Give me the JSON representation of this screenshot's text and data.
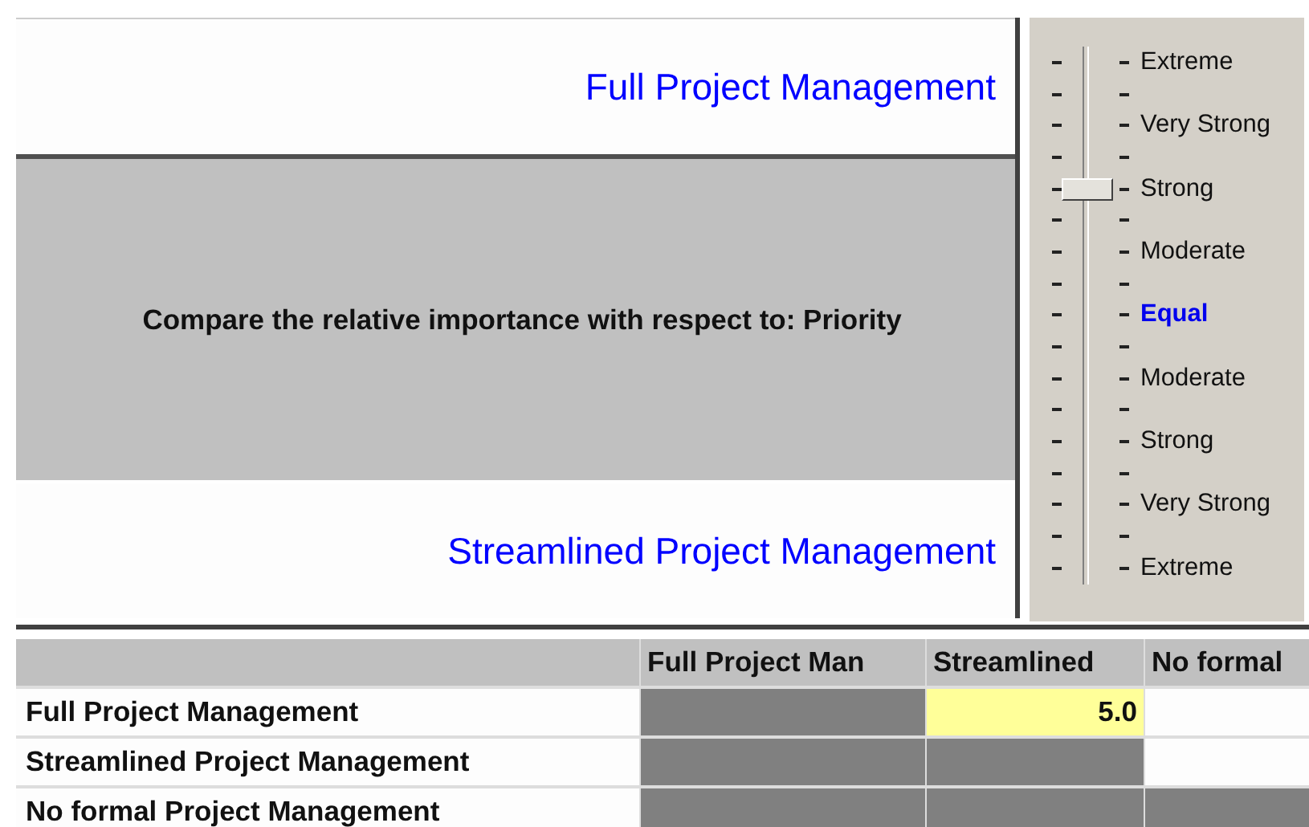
{
  "comparison": {
    "top_option": "Full Project Management",
    "prompt": "Compare the relative importance with respect to: Priority",
    "bottom_option": "Streamlined Project Management"
  },
  "scale": {
    "level": 0.75,
    "labels": [
      {
        "text": "Extreme",
        "highlighted": false
      },
      {
        "text": "Very Strong",
        "highlighted": false
      },
      {
        "text": "Strong",
        "highlighted": false
      },
      {
        "text": "Moderate",
        "highlighted": false
      },
      {
        "text": "Equal",
        "highlighted": true
      },
      {
        "text": "Moderate",
        "highlighted": false
      },
      {
        "text": "Strong",
        "highlighted": false
      },
      {
        "text": "Very Strong",
        "highlighted": false
      },
      {
        "text": "Extreme",
        "highlighted": false
      }
    ]
  },
  "table": {
    "columns": [
      "Full Project Man",
      "Streamlined",
      "No formal"
    ],
    "rows": [
      {
        "label": "Full Project Management",
        "cells": [
          {
            "kind": "blocked"
          },
          {
            "kind": "entry",
            "value": "5.0",
            "selected": true
          },
          {
            "kind": "entry",
            "selected": false
          }
        ]
      },
      {
        "label": "Streamlined Project Management",
        "cells": [
          {
            "kind": "blocked"
          },
          {
            "kind": "blocked"
          },
          {
            "kind": "entry",
            "selected": false
          }
        ]
      },
      {
        "label": "No formal Project Management",
        "cells": [
          {
            "kind": "blocked"
          },
          {
            "kind": "blocked"
          },
          {
            "kind": "blocked"
          }
        ]
      }
    ]
  }
}
